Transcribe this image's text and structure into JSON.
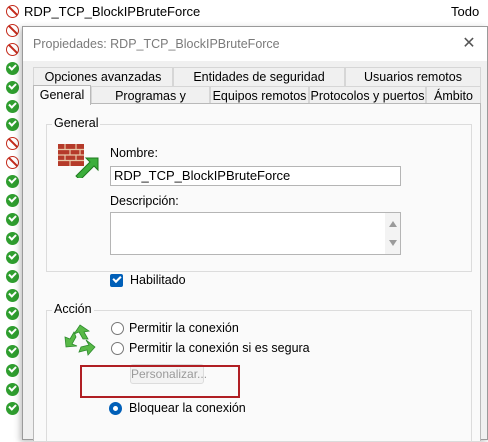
{
  "background_list": {
    "first_row_name": "RDP_TCP_BlockIPBruteForce",
    "first_row_profile": "Todo",
    "rows": [
      {
        "icon": "block"
      },
      {
        "icon": "block"
      },
      {
        "icon": "block"
      },
      {
        "icon": "allow"
      },
      {
        "icon": "allow"
      },
      {
        "icon": "allow"
      },
      {
        "icon": "allow"
      },
      {
        "icon": "block"
      },
      {
        "icon": "block"
      },
      {
        "icon": "allow"
      },
      {
        "icon": "allow"
      },
      {
        "icon": "allow"
      },
      {
        "icon": "allow"
      },
      {
        "icon": "allow"
      },
      {
        "icon": "allow"
      },
      {
        "icon": "allow"
      },
      {
        "icon": "allow"
      },
      {
        "icon": "allow"
      },
      {
        "icon": "allow"
      },
      {
        "icon": "allow"
      },
      {
        "icon": "allow"
      },
      {
        "icon": "allow"
      }
    ]
  },
  "dialog": {
    "title": "Propiedades: RDP_TCP_BlockIPBruteForce",
    "close_glyph": "✕",
    "tabs_row1": [
      "Opciones avanzadas",
      "Entidades de seguridad locales",
      "Usuarios remotos"
    ],
    "tabs_row2": [
      "General",
      "Programas y servicios",
      "Equipos remotos",
      "Protocolos y puertos",
      "Ámbito"
    ],
    "active_tab": "General"
  },
  "general": {
    "group_title": "General",
    "name_label": "Nombre:",
    "name_value": "RDP_TCP_BlockIPBruteForce",
    "description_label": "Descripción:",
    "description_value": "",
    "enabled_label": "Habilitado",
    "enabled_checked": true
  },
  "action": {
    "group_title": "Acción",
    "options": [
      "Permitir la conexión",
      "Permitir la conexión si es segura",
      "Bloquear la conexión"
    ],
    "selected_option": "Bloquear la conexión",
    "customize_label": "Personalizar..."
  },
  "colors": {
    "accent": "#005fb8",
    "highlight_box": "#b01e23",
    "block_icon": "#c42b1c",
    "allow_icon": "#2f9e2f"
  }
}
